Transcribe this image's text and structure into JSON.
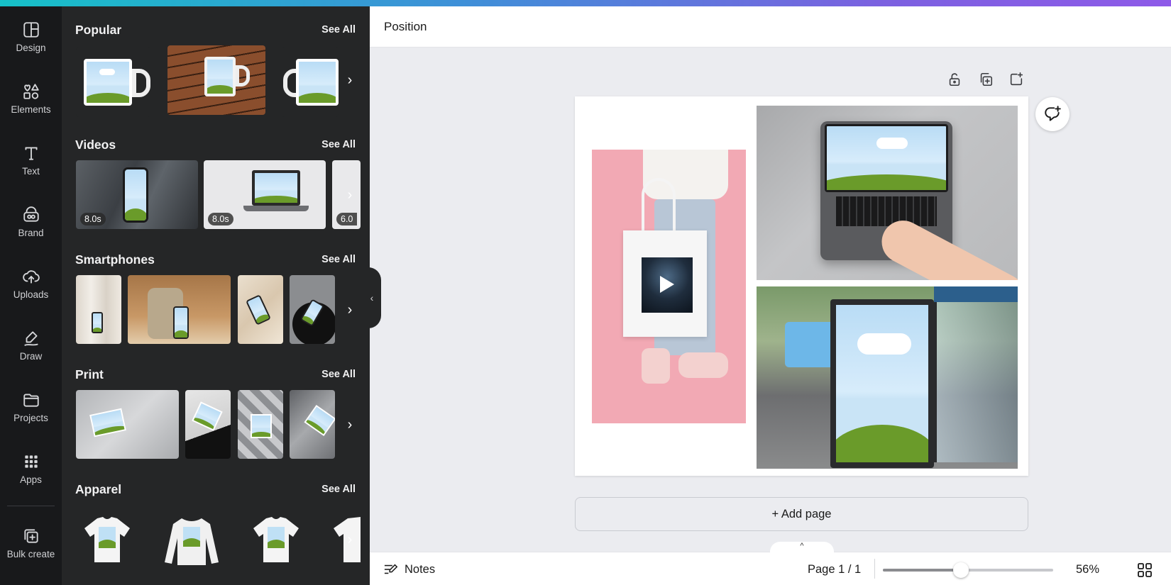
{
  "rail": {
    "items": [
      {
        "label": "Design",
        "icon": "layout-icon"
      },
      {
        "label": "Elements",
        "icon": "shapes-icon"
      },
      {
        "label": "Text",
        "icon": "text-icon"
      },
      {
        "label": "Brand",
        "icon": "brand-icon"
      },
      {
        "label": "Uploads",
        "icon": "cloud-upload-icon"
      },
      {
        "label": "Draw",
        "icon": "draw-icon"
      },
      {
        "label": "Projects",
        "icon": "folder-icon"
      },
      {
        "label": "Apps",
        "icon": "apps-grid-icon"
      },
      {
        "label": "Bulk create",
        "icon": "bulk-create-icon"
      }
    ]
  },
  "panel": {
    "sections": [
      {
        "title": "Popular",
        "see_all": "See All"
      },
      {
        "title": "Videos",
        "see_all": "See All",
        "badges": [
          "8.0s",
          "8.0s",
          "6.0"
        ]
      },
      {
        "title": "Smartphones",
        "see_all": "See All"
      },
      {
        "title": "Print",
        "see_all": "See All"
      },
      {
        "title": "Apparel",
        "see_all": "See All"
      }
    ]
  },
  "main": {
    "title": "Position",
    "add_page": "+ Add page"
  },
  "footer": {
    "notes": "Notes",
    "page": "Page 1 / 1",
    "zoom": "56%",
    "zoom_level": 0.56
  },
  "colors": {
    "rail_bg": "#18191b",
    "panel_bg": "#252627",
    "canvas_bg": "#ebecf0",
    "accent_gradient_start": "#16c1c8",
    "accent_gradient_end": "#8e5ae8"
  }
}
